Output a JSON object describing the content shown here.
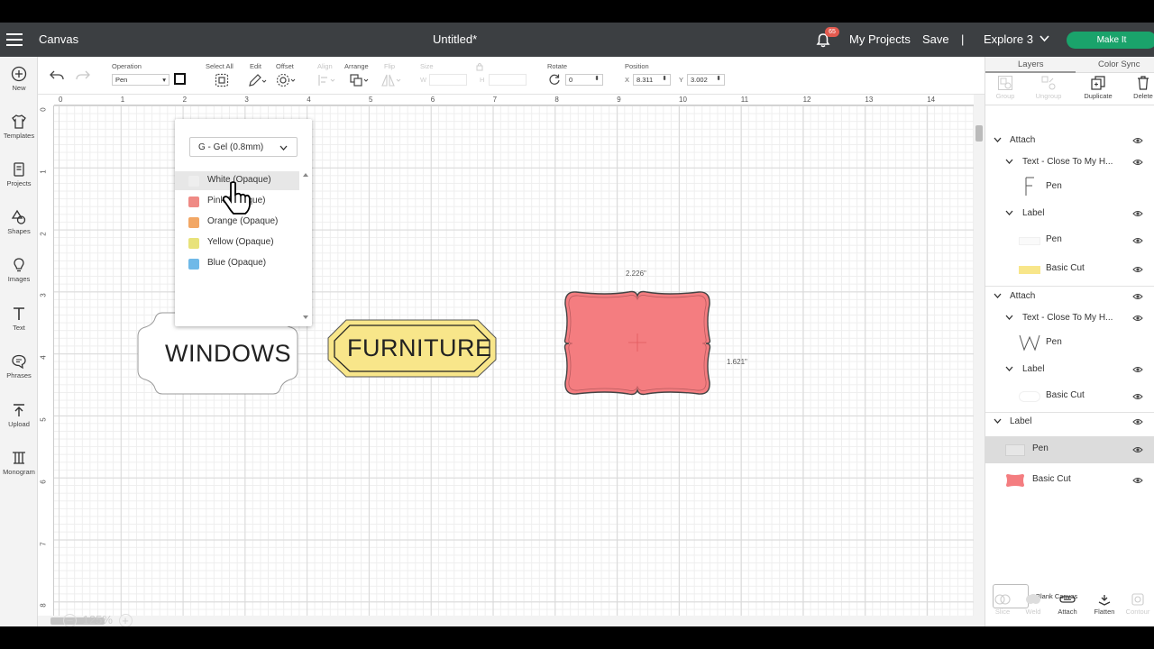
{
  "topbar": {
    "title": "Canvas",
    "doc_title": "Untitled*",
    "notifications": "65",
    "my_projects": "My Projects",
    "save": "Save",
    "separator": "|",
    "machine": "Explore 3",
    "make_it": "Make It"
  },
  "left_toolbar": {
    "new": "New",
    "templates": "Templates",
    "projects": "Projects",
    "shapes": "Shapes",
    "images": "Images",
    "text": "Text",
    "phrases": "Phrases",
    "upload": "Upload",
    "monogram": "Monogram"
  },
  "editbar": {
    "operation_label": "Operation",
    "operation_value": "Pen",
    "select_all": "Select All",
    "edit": "Edit",
    "offset": "Offset",
    "align": "Align",
    "arrange": "Arrange",
    "flip": "Flip",
    "size": "Size",
    "w": "W",
    "h": "H",
    "rotate": "Rotate",
    "rotate_value": "0",
    "position": "Position",
    "x_label": "X",
    "x_value": "8.311",
    "y_label": "Y",
    "y_value": "3.002"
  },
  "ruler": {
    "h": [
      "0",
      "1",
      "2",
      "3",
      "4",
      "5",
      "6",
      "7",
      "8",
      "9",
      "10",
      "11",
      "12",
      "13",
      "14"
    ],
    "v": [
      "0",
      "1",
      "2",
      "3",
      "4",
      "5",
      "6",
      "7",
      "8"
    ]
  },
  "canvas": {
    "windows_label": "WINDOWS",
    "furniture_label": "FURNITURE",
    "width_dim": "2.226\"",
    "height_dim": "1.621\"",
    "zoom": "125%",
    "zoom_minus": "−",
    "zoom_plus": "+"
  },
  "dropdown": {
    "pen_type": "G - Gel (0.8mm)",
    "colors": [
      {
        "label": "White (Opaque)",
        "color": "#eeeeee"
      },
      {
        "label": "Pink (Opaque)",
        "color": "#ef8a85"
      },
      {
        "label": "Orange (Opaque)",
        "color": "#f2a765"
      },
      {
        "label": "Yellow (Opaque)",
        "color": "#e8e27a"
      },
      {
        "label": "Blue (Opaque)",
        "color": "#6fb9e8"
      }
    ]
  },
  "right_panel": {
    "tab_layers": "Layers",
    "tab_color_sync": "Color Sync",
    "group": "Group",
    "ungroup": "Ungroup",
    "duplicate": "Duplicate",
    "delete": "Delete",
    "layers": {
      "attach1": "Attach",
      "text1": "Text - Close To My H...",
      "pen1": "Pen",
      "label1": "Label",
      "pen2": "Pen",
      "basic_cut1": "Basic Cut",
      "attach2": "Attach",
      "text2": "Text - Close To My H...",
      "pen3": "Pen",
      "label2": "Label",
      "basic_cut2": "Basic Cut",
      "label3": "Label",
      "pen4": "Pen",
      "basic_cut3": "Basic Cut"
    },
    "blank_canvas": "Blank Canvas",
    "slice": "Slice",
    "weld": "Weld",
    "attach": "Attach",
    "flatten": "Flatten",
    "contour": "Contour"
  },
  "colors": {
    "topbar": "#3c3f42",
    "make_it": "#1aa36b",
    "pink_label": "#f47d80",
    "yellow_label": "#f8e68a",
    "badge": "#e35a4f"
  }
}
